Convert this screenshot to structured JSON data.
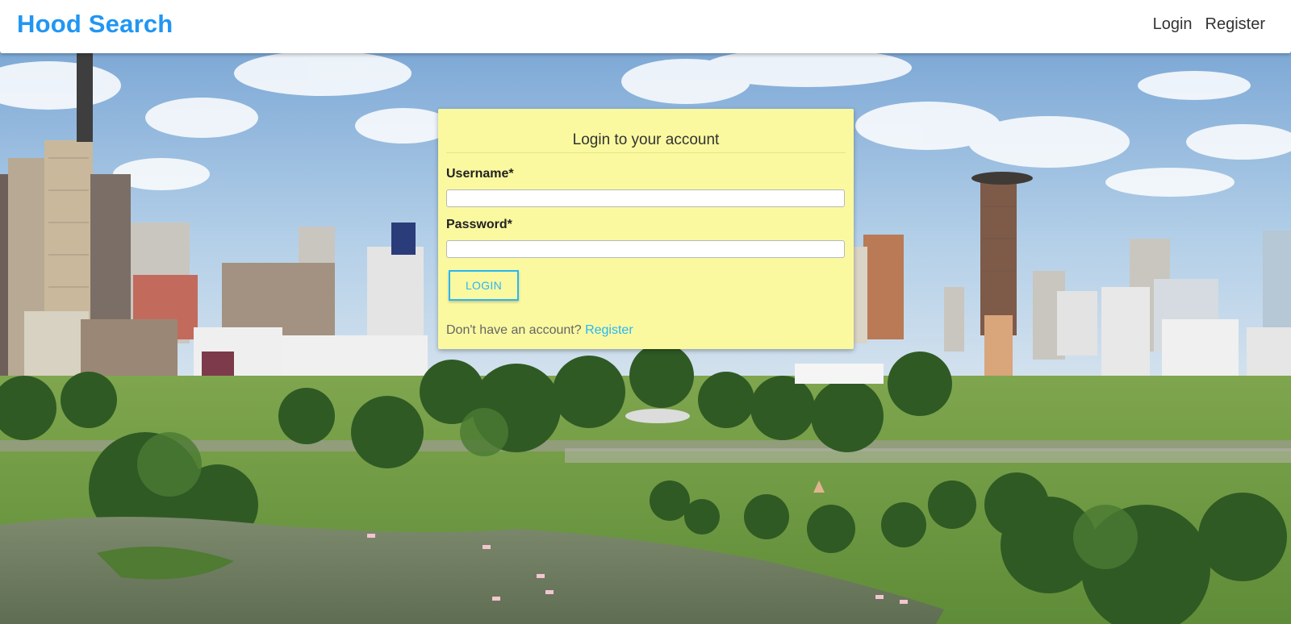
{
  "navbar": {
    "brand": "Hood Search",
    "links": [
      "Login",
      "Register"
    ],
    "brand_color": "#2196f3"
  },
  "login_card": {
    "title": "Login to your account",
    "username_label": "Username*",
    "username_value": "",
    "password_label": "Password*",
    "password_value": "",
    "submit_label": "LOGIN",
    "footer_text": "Don't have an account?",
    "footer_link": "Register",
    "background_color": "#faf9a0",
    "accent_color": "#29b6f6"
  },
  "background": {
    "scene": "city skyline with park and lake"
  }
}
